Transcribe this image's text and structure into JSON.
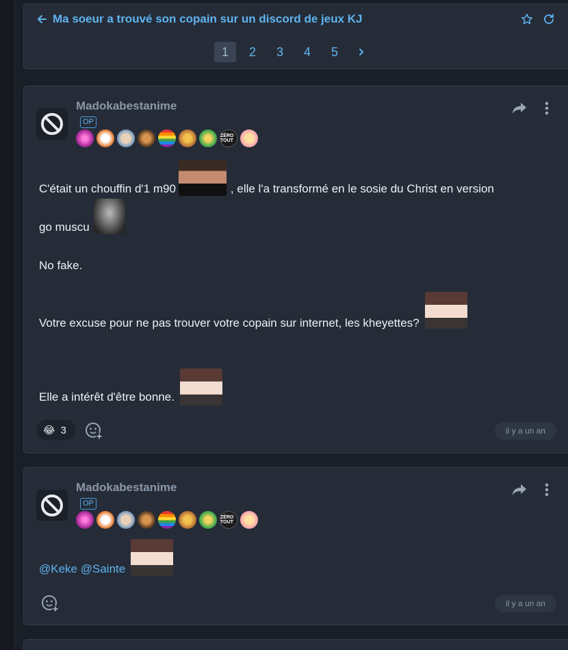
{
  "topic": {
    "title": "Ma soeur a trouvé son copain sur un discord de jeux KJ",
    "pages": [
      "1",
      "2",
      "3",
      "4",
      "5"
    ],
    "current_page": "1"
  },
  "posts": [
    {
      "username": "Madokabestanime",
      "op_label": "OP",
      "badges": [
        "spiral-badge",
        "chicken-badge",
        "old-man-badge",
        "figure-badge",
        "rainbow-badge",
        "bear-badge",
        "frog-badge",
        "zero-tout-badge",
        "anime-girl-badge"
      ],
      "badge_text_zero": "ZÉRO TOUT",
      "lines": {
        "l1a": "C'était un chouffin d'1 m90",
        "l1b": ", elle l'a transformé en le sosie du Christ en version",
        "l2": "go muscu",
        "l3": "No fake.",
        "l4": "Votre excuse pour ne pas trouver votre copain sur internet, les kheyettes?",
        "l5": "Elle a intérêt d'être bonne."
      },
      "reaction": {
        "emoji": "😂",
        "count": "3"
      },
      "time": "il y a un an"
    },
    {
      "username": "Madokabestanime",
      "op_label": "OP",
      "mention_1": "@Keke",
      "mention_2": "@Sainte",
      "time": "il y a un an"
    }
  ],
  "colors": {
    "accent": "#5fb3ef",
    "card": "#252c38",
    "background": "#1a1f27"
  }
}
